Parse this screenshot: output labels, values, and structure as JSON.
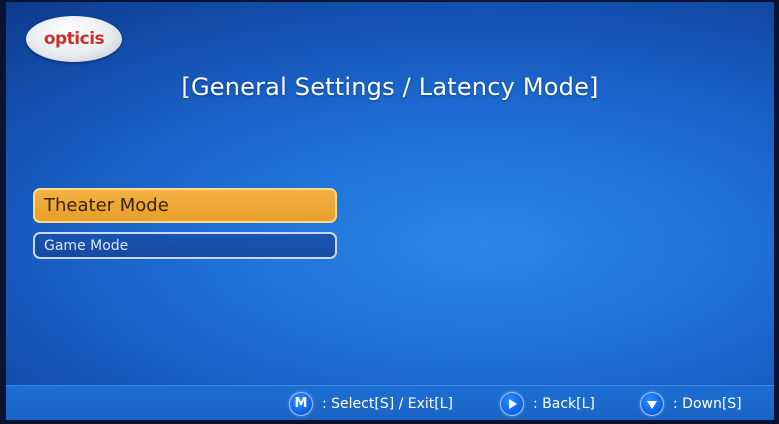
{
  "logo": {
    "text": "opticis"
  },
  "title": "[General Settings / Latency Mode]",
  "menu": {
    "items": [
      {
        "label": "Theater Mode",
        "selected": true
      },
      {
        "label": "Game Mode",
        "selected": false
      }
    ]
  },
  "hints": {
    "select": {
      "key": "M",
      "label": ": Select[S] / Exit[L]"
    },
    "back": {
      "icon": "right-arrow-icon",
      "label": ": Back[L]"
    },
    "down": {
      "icon": "down-arrow-icon",
      "label": ": Down[S]"
    }
  },
  "colors": {
    "background": "#1e6fd6",
    "selected_item": "#f0aa38",
    "hint_button": "#0d5fe0"
  }
}
